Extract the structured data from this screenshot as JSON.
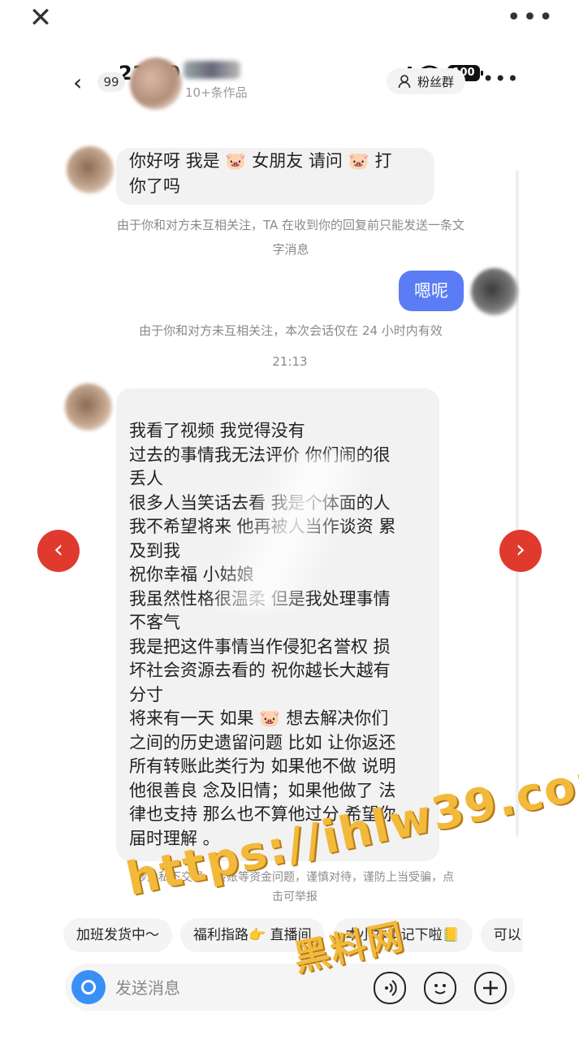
{
  "topbar": {
    "close_label": "✕",
    "more_label": "•••"
  },
  "status": {
    "time": "21:19",
    "battery": "100"
  },
  "header": {
    "back_label": "‹",
    "unread": "99",
    "subtitle": "10+条作品",
    "fans_label": "粉丝群",
    "more_label": "•••"
  },
  "messages": {
    "first_in_line1_a": "你好呀 我是",
    "first_in_line1_b": "女朋友 请问",
    "first_in_line1_c": "打",
    "first_in_line2": "你了吗",
    "sys1_line1": "由于你和对方未互相关注，TA 在收到你的回复前只能发送一条文",
    "sys1_line2": "字消息",
    "out1": "嗯呢",
    "sys2": "由于你和对方未互相关注，本次会话仅在 24 小时内有效",
    "timestamp": "21:13",
    "long_lines": [
      "我看了视频 我觉得没有",
      "过去的事情我无法评价 你们闹的很",
      "丢人",
      "很多人当笑话去看 我是个体面的人",
      "我不希望将来 他再被人当作谈资 累",
      "及到我",
      "祝你幸福 小姑娘",
      "我虽然性格很温柔 但是我处理事情",
      "不客气",
      "我是把这件事情当作侵犯名誉权 损",
      "坏社会资源去看的 祝你越长大越有",
      "分寸"
    ],
    "long_line13_a": "将来有一天 如果",
    "long_line13_b": "想去解决你们",
    "long_lines_tail": [
      "之间的历史遗留问题 比如 让你返还",
      "所有转账此类行为 如果他不做 说明",
      "他很善良 念及旧情；如果他做了 法",
      "律也支持 那么也不算他过分 希望你",
      "届时理解 。"
    ],
    "sys3_line1": "涉及私下交易、转账等资金问题，谨慎对待，谨防上当受骗，点",
    "sys3_line2": "击可举报",
    "pig_emoji": "🐷"
  },
  "quick_replies": [
    "加班发货中～",
    "福利指路👉 直播间",
    "本小本本记下啦📒",
    "可以"
  ],
  "input": {
    "placeholder": "发送消息"
  },
  "nav": {
    "prev": "‹",
    "next": "›"
  },
  "watermark": {
    "line1": "https://ihlw39.com",
    "line2": "黑料网"
  }
}
